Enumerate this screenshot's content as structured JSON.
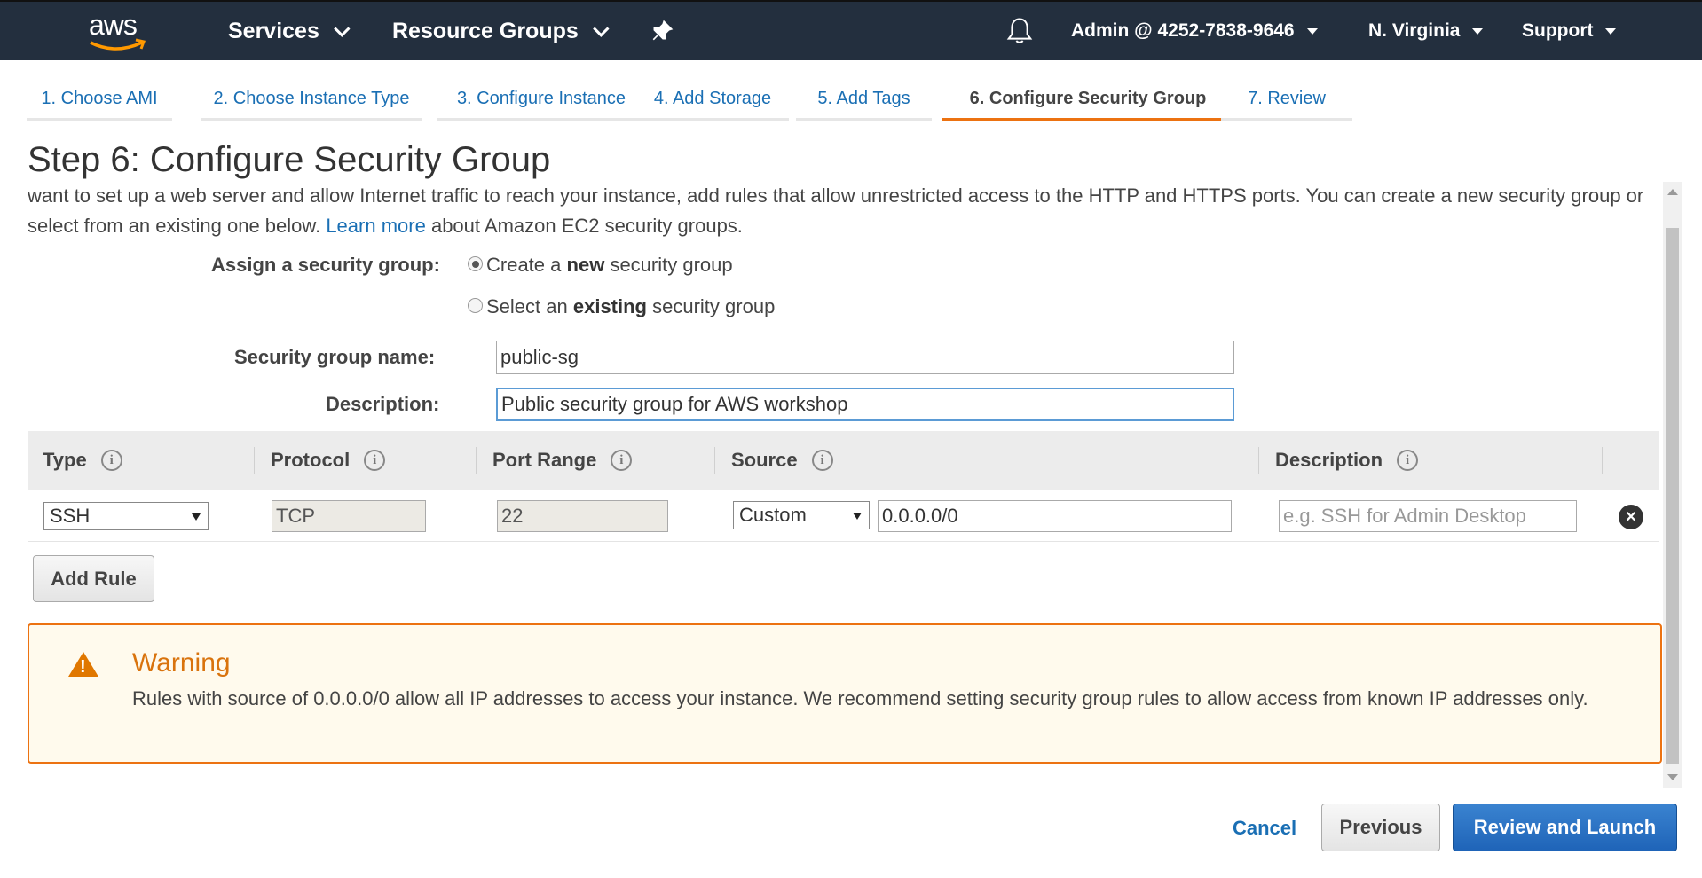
{
  "nav": {
    "logo_text": "aws",
    "services": "Services",
    "resource_groups": "Resource Groups",
    "account": "Admin @ 4252-7838-9646",
    "region": "N. Virginia",
    "support": "Support"
  },
  "steps": [
    {
      "label": "1. Choose AMI"
    },
    {
      "label": "2. Choose Instance Type"
    },
    {
      "label": "3. Configure Instance"
    },
    {
      "label": "4. Add Storage"
    },
    {
      "label": "5. Add Tags"
    },
    {
      "label": "6. Configure Security Group",
      "active": true
    },
    {
      "label": "7. Review"
    }
  ],
  "page": {
    "title": "Step 6: Configure Security Group",
    "intro_text": "want to set up a web server and allow Internet traffic to reach your instance, add rules that allow unrestricted access to the HTTP and HTTPS ports. You can create a new security group or select from an existing one below.",
    "learn_more": "Learn more",
    "intro_suffix": "about Amazon EC2 security groups."
  },
  "assign": {
    "label": "Assign a security group:",
    "option_new_prefix": "Create a",
    "option_new_bold": "new",
    "option_new_suffix": "security group",
    "option_existing_prefix": "Select an",
    "option_existing_bold": "existing",
    "option_existing_suffix": "security group",
    "selected": "new"
  },
  "form": {
    "name_label": "Security group name:",
    "name_value": "public-sg",
    "desc_label": "Description:",
    "desc_value": "Public security group for AWS workshop"
  },
  "table": {
    "headers": [
      "Type",
      "Protocol",
      "Port Range",
      "Source",
      "Description"
    ],
    "info_icon": "i",
    "rows": [
      {
        "type": "SSH",
        "protocol": "TCP",
        "port_range": "22",
        "source_type": "Custom",
        "source_value": "0.0.0.0/0",
        "description_placeholder": "e.g. SSH for Admin Desktop"
      }
    ]
  },
  "add_rule": "Add Rule",
  "warning": {
    "title": "Warning",
    "body": "Rules with source of 0.0.0.0/0 allow all IP addresses to access your instance. We recommend setting security group rules to allow access from known IP addresses only."
  },
  "footer": {
    "cancel": "Cancel",
    "previous": "Previous",
    "review_launch": "Review and Launch"
  },
  "colors": {
    "nav_bg": "#232f3e",
    "link": "#1a6fb4",
    "active_tab": "#ec7211",
    "warning_border": "#ec7211",
    "warning_bg": "#fffaed",
    "primary_button": "#1f64b8"
  }
}
